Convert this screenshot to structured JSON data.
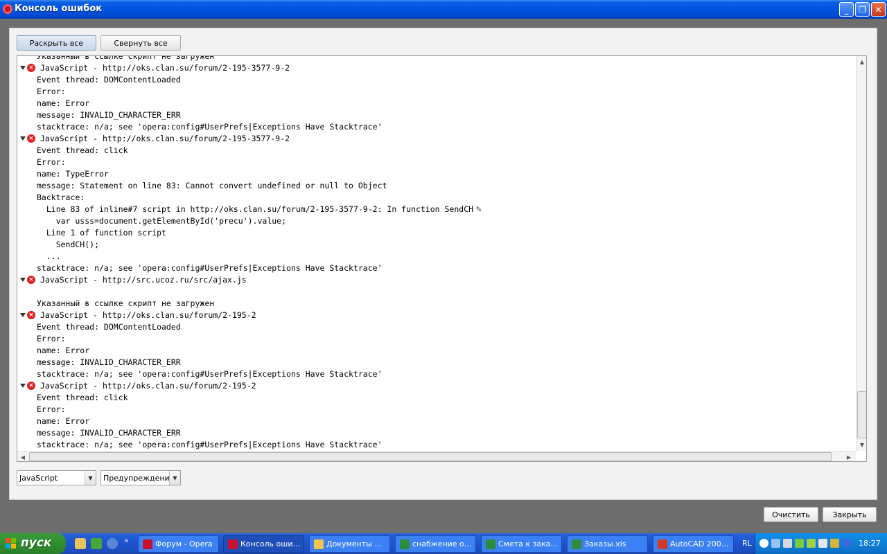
{
  "window": {
    "title": "Консоль ошибок"
  },
  "toolbar": {
    "expand_all": "Раскрыть все",
    "collapse_all": "Свернуть все"
  },
  "console": {
    "partial_top_line": "Указанный в ссылке скрипт не загружен",
    "entries": [
      {
        "header": "JavaScript - http://oks.clan.su/forum/2-195-3577-9-2",
        "lines": [
          "Event thread: DOMContentLoaded",
          "Error:",
          "name: Error",
          "message: INVALID_CHARACTER_ERR",
          "stacktrace: n/a; see 'opera:config#UserPrefs|Exceptions Have Stacktrace'"
        ]
      },
      {
        "header": "JavaScript - http://oks.clan.su/forum/2-195-3577-9-2",
        "lines": [
          "Event thread: click",
          "Error:",
          "name: TypeError",
          "message: Statement on line 83: Cannot convert undefined or null to Object",
          "Backtrace:",
          "  Line 83 of inline#7 script in http://oks.clan.su/forum/2-195-3577-9-2: In function SendCH",
          "    var usss=document.getElementById('precu').value;",
          "  Line 1 of function script",
          "    SendCH();",
          "  ...",
          "stacktrace: n/a; see 'opera:config#UserPrefs|Exceptions Have Stacktrace'"
        ]
      },
      {
        "header": "JavaScript - http://src.ucoz.ru/src/ajax.js",
        "lines": [
          "",
          "Указанный в ссылке скрипт не загружен"
        ]
      },
      {
        "header": "JavaScript - http://oks.clan.su/forum/2-195-2",
        "lines": [
          "Event thread: DOMContentLoaded",
          "Error:",
          "name: Error",
          "message: INVALID_CHARACTER_ERR",
          "stacktrace: n/a; see 'opera:config#UserPrefs|Exceptions Have Stacktrace'"
        ]
      },
      {
        "header": "JavaScript - http://oks.clan.su/forum/2-195-2",
        "lines": [
          "Event thread: click",
          "Error:",
          "name: Error",
          "message: INVALID_CHARACTER_ERR",
          "stacktrace: n/a; see 'opera:config#UserPrefs|Exceptions Have Stacktrace'"
        ]
      }
    ]
  },
  "filters": {
    "source_value": "JavaScript",
    "level_value": "Предупреждения"
  },
  "footer": {
    "clear_label": "Очистить",
    "close_label": "Закрыть"
  },
  "taskbar": {
    "start_label": "пуск",
    "tasks": [
      {
        "label": "Форум - Opera",
        "active": false,
        "icon_color": "#c8102e"
      },
      {
        "label": "Консоль оши...",
        "active": true,
        "icon_color": "#c8102e"
      },
      {
        "label": "Документы ...",
        "active": false,
        "icon_color": "#f3c64b"
      },
      {
        "label": "снабжение о...",
        "active": false,
        "icon_color": "#2e8b3a"
      },
      {
        "label": "Смета к зака...",
        "active": false,
        "icon_color": "#2e8b3a"
      },
      {
        "label": "Заказы.xls",
        "active": false,
        "icon_color": "#2e8b3a"
      },
      {
        "label": "AutoCAD 200...",
        "active": false,
        "icon_color": "#d43a2a"
      }
    ],
    "language": "RL",
    "clock": "18:27"
  }
}
